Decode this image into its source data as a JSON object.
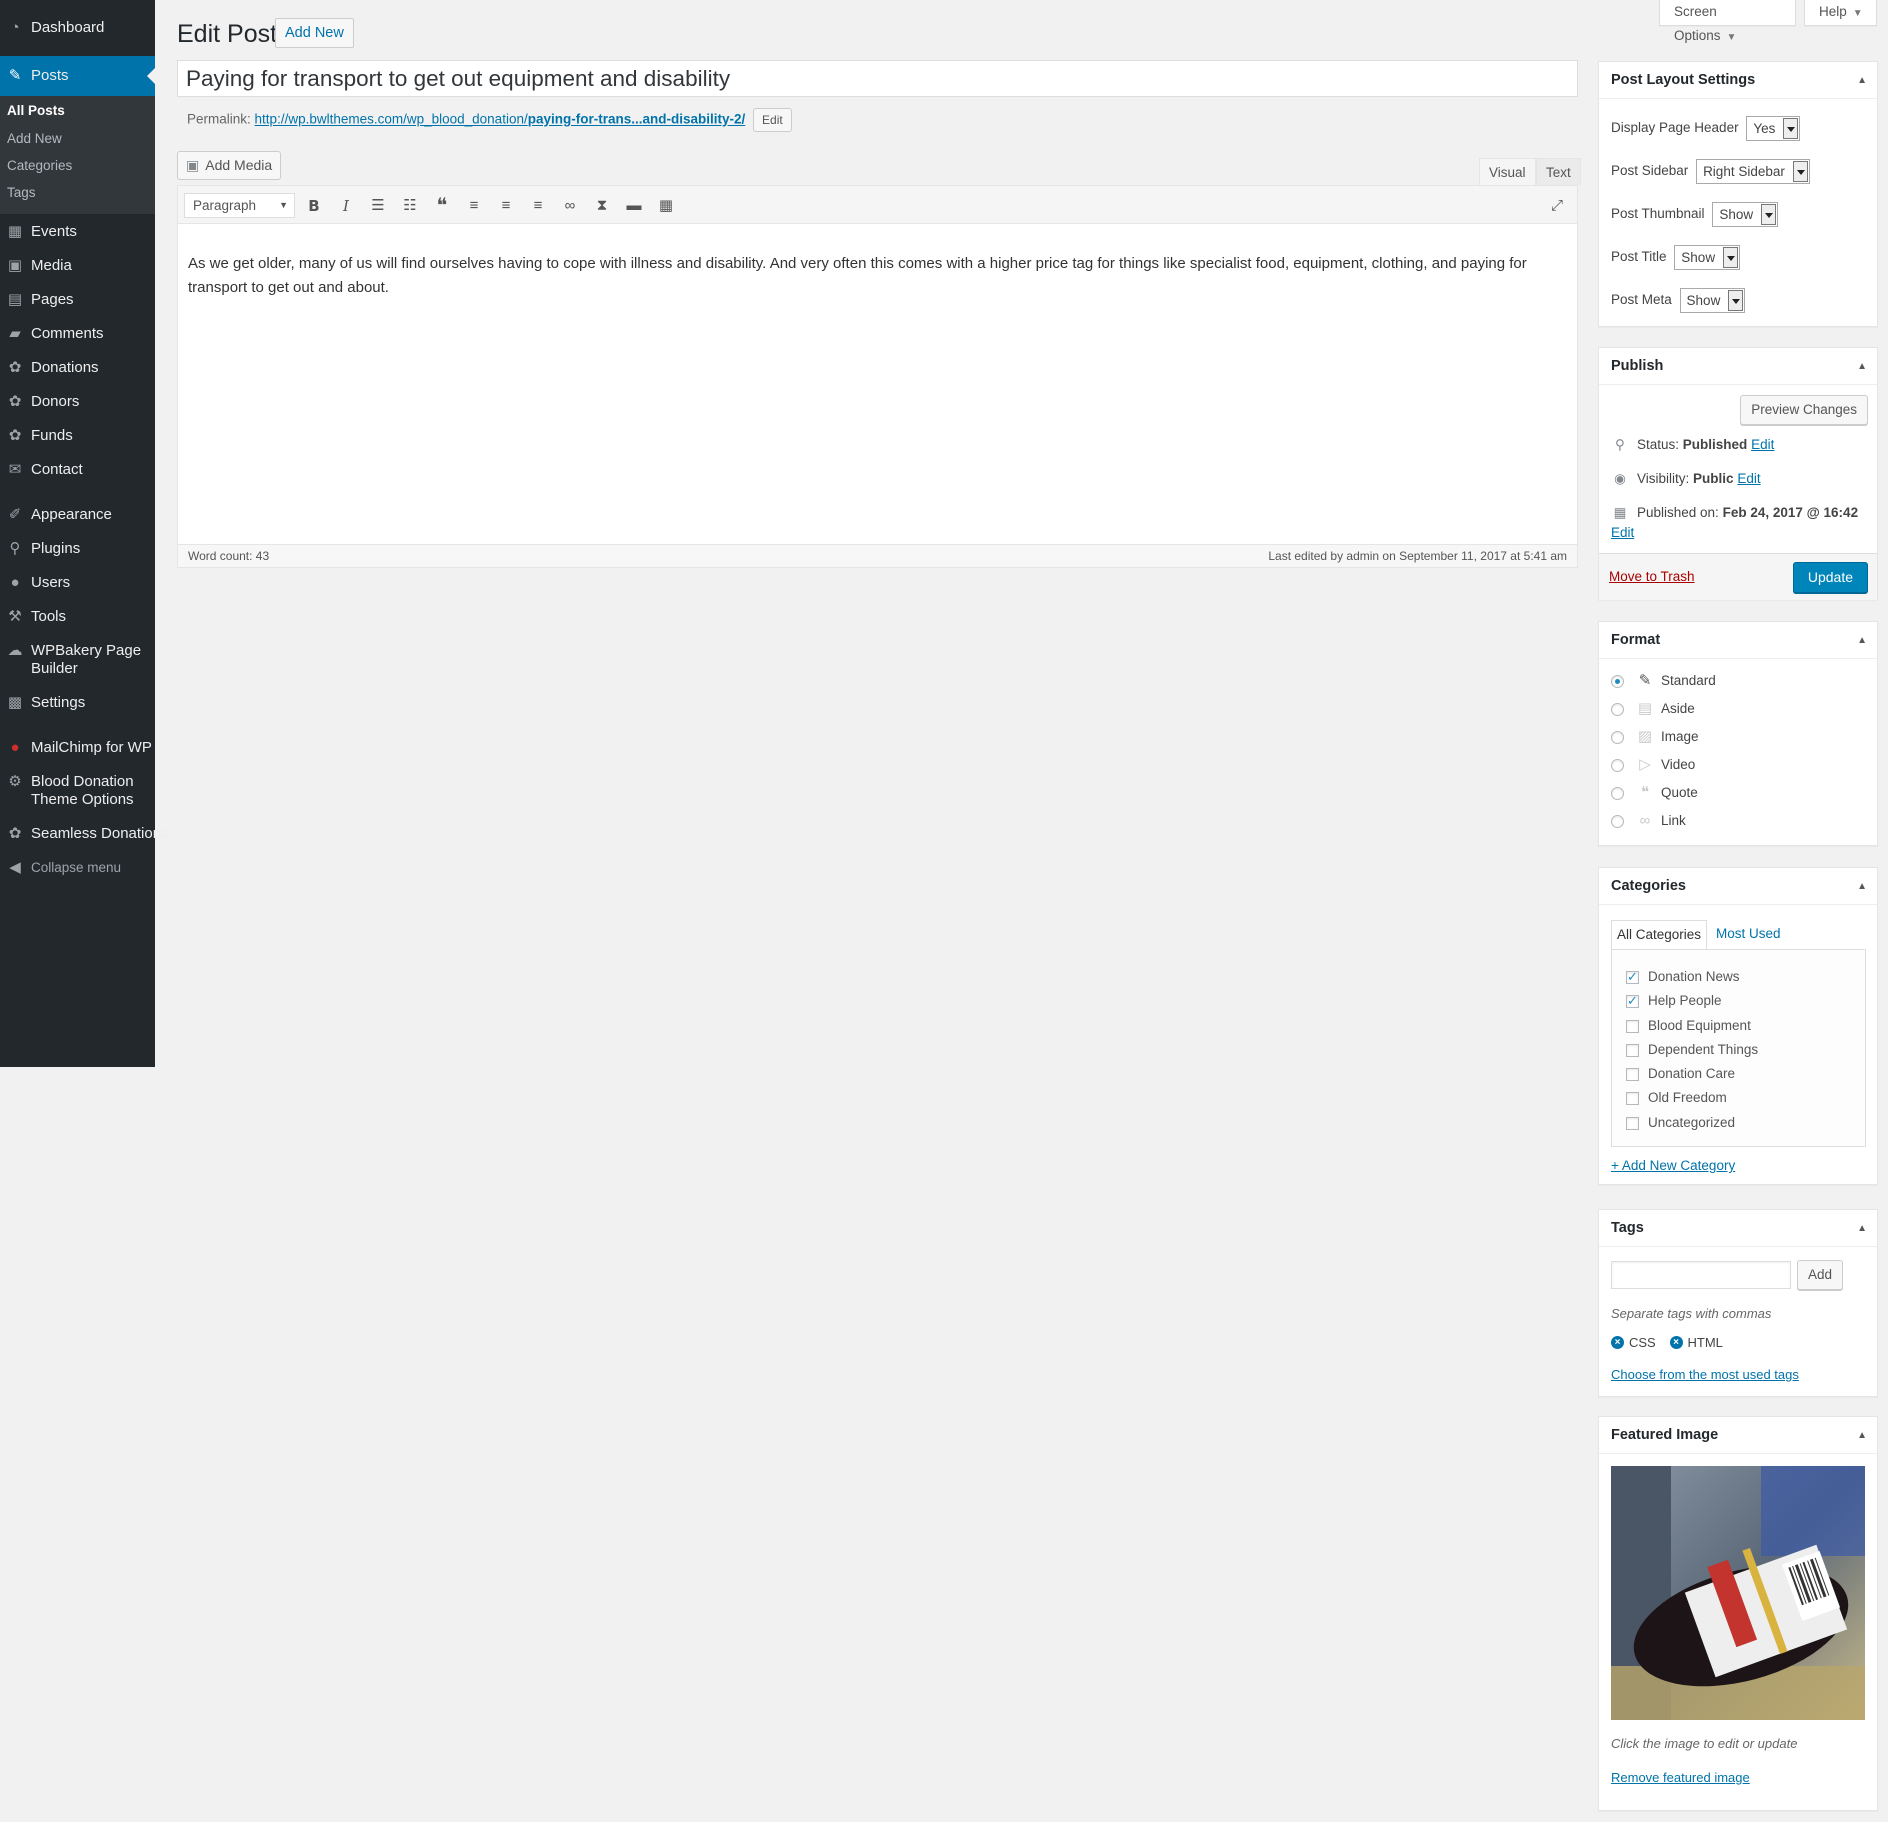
{
  "admin_menu": {
    "items": [
      {
        "label": "Dashboard",
        "icon": "dashboard-icon",
        "glyph": "◔"
      },
      {
        "label": "Posts",
        "icon": "pin-icon",
        "glyph": "✎"
      },
      {
        "label": "Events",
        "icon": "calendar-icon",
        "glyph": "▦"
      },
      {
        "label": "Media",
        "icon": "media-icon",
        "glyph": "▣"
      },
      {
        "label": "Pages",
        "icon": "pages-icon",
        "glyph": "▤"
      },
      {
        "label": "Comments",
        "icon": "comments-icon",
        "glyph": "▰"
      },
      {
        "label": "Donations",
        "icon": "palm-icon",
        "glyph": "✿"
      },
      {
        "label": "Donors",
        "icon": "palm-icon",
        "glyph": "✿"
      },
      {
        "label": "Funds",
        "icon": "palm-icon",
        "glyph": "✿"
      },
      {
        "label": "Contact",
        "icon": "mail-icon",
        "glyph": "✉"
      },
      {
        "label": "Appearance",
        "icon": "brush-icon",
        "glyph": "✐"
      },
      {
        "label": "Plugins",
        "icon": "plug-icon",
        "glyph": "⚲"
      },
      {
        "label": "Users",
        "icon": "users-icon",
        "glyph": "●"
      },
      {
        "label": "Tools",
        "icon": "wrench-icon",
        "glyph": "⚒"
      },
      {
        "label": "WPBakery Page Builder",
        "label_line1": "WPBakery Page",
        "label_line2": "Builder",
        "icon": "cloud-icon",
        "glyph": "☁"
      },
      {
        "label": "Settings",
        "icon": "settings-icon",
        "glyph": "▩"
      },
      {
        "label": "MailChimp for WP",
        "icon": "mailchimp-icon",
        "glyph": "●"
      },
      {
        "label": "Blood Donation Theme Options",
        "label_line1": "Blood Donation",
        "label_line2": "Theme Options",
        "icon": "gear-icon",
        "glyph": "⚙"
      },
      {
        "label": "Seamless Donations",
        "icon": "palm-icon",
        "glyph": "✿"
      },
      {
        "label": "Collapse menu",
        "icon": "collapse-icon",
        "glyph": "◀"
      }
    ],
    "posts_submenu": [
      "All Posts",
      "Add New",
      "Categories",
      "Tags"
    ]
  },
  "top_buttons": {
    "screen_options": "Screen Options",
    "help": "Help"
  },
  "header": {
    "title": "Edit Post",
    "add_new": "Add New"
  },
  "post": {
    "title": "Paying for transport to get out equipment and disability",
    "permalink_label": "Permalink:",
    "permalink_base": "http://wp.bwlthemes.com/wp_blood_donation/",
    "permalink_slug": "paying-for-trans...and-disability-2/",
    "permalink_edit": "Edit",
    "add_media": "Add Media",
    "tab_visual": "Visual",
    "tab_text": "Text",
    "format": "Paragraph",
    "content": "As we get older, many of us will find ourselves having to cope with illness and disability. And very often this comes with a higher price tag for things like specialist food, equipment, clothing, and paying for transport to get out and about.",
    "word_count": "Word count: 43",
    "last_edited": "Last edited by admin on September 11, 2017 at 5:41 am"
  },
  "layout_settings": {
    "title": "Post Layout Settings",
    "rows": [
      {
        "label": "Display Page Header",
        "value": "Yes"
      },
      {
        "label": "Post Sidebar",
        "value": "Right Sidebar"
      },
      {
        "label": "Post Thumbnail",
        "value": "Show"
      },
      {
        "label": "Post Title",
        "value": "Show"
      },
      {
        "label": "Post Meta",
        "value": "Show"
      }
    ]
  },
  "publish": {
    "title": "Publish",
    "preview": "Preview Changes",
    "status_label": "Status:",
    "status_value": "Published",
    "visibility_label": "Visibility:",
    "visibility_value": "Public",
    "published_label": "Published on:",
    "published_value": "Feb 24, 2017 @ 16:42",
    "edit": "Edit",
    "trash": "Move to Trash",
    "update": "Update"
  },
  "format_box": {
    "title": "Format",
    "options": [
      {
        "label": "Standard",
        "icon": "pin-icon",
        "glyph": "✎",
        "checked": true
      },
      {
        "label": "Aside",
        "icon": "aside-icon",
        "glyph": "▤",
        "checked": false
      },
      {
        "label": "Image",
        "icon": "image-icon",
        "glyph": "▨",
        "checked": false
      },
      {
        "label": "Video",
        "icon": "video-icon",
        "glyph": "▷",
        "checked": false
      },
      {
        "label": "Quote",
        "icon": "quote-icon",
        "glyph": "❝",
        "checked": false
      },
      {
        "label": "Link",
        "icon": "link-icon",
        "glyph": "∞",
        "checked": false
      }
    ]
  },
  "categories": {
    "title": "Categories",
    "tab_all": "All Categories",
    "tab_most_used": "Most Used",
    "items": [
      {
        "label": "Donation News",
        "checked": true
      },
      {
        "label": "Help People",
        "checked": true
      },
      {
        "label": "Blood Equipment",
        "checked": false
      },
      {
        "label": "Dependent Things",
        "checked": false
      },
      {
        "label": "Donation Care",
        "checked": false
      },
      {
        "label": "Old Freedom",
        "checked": false
      },
      {
        "label": "Uncategorized",
        "checked": false
      }
    ],
    "add_new": "+ Add New Category"
  },
  "tags": {
    "title": "Tags",
    "add": "Add",
    "hint": "Separate tags with commas",
    "items": [
      "CSS",
      "HTML"
    ],
    "choose": "Choose from the most used tags"
  },
  "featured_image": {
    "title": "Featured Image",
    "hint": "Click the image to edit or update",
    "remove": "Remove featured image"
  },
  "colors": {
    "menu_bg": "#23282d",
    "menu_active": "#0073aa",
    "primary": "#0085ba",
    "link": "#0073aa",
    "danger": "#a00"
  }
}
